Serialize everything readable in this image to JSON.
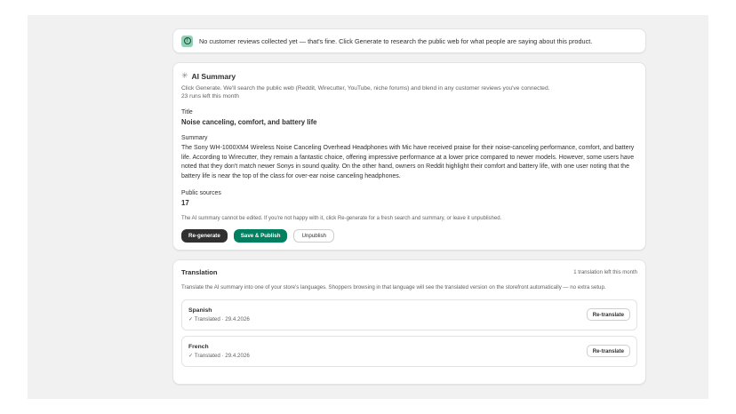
{
  "banner": {
    "text": "No customer reviews collected yet — that's fine. Click Generate to research the public web for what people are saying about this product."
  },
  "summary": {
    "title": "AI Summary",
    "subtitle": "Click Generate. We'll search the public web (Reddit, Wirecutter, YouTube, niche forums) and blend in any customer reviews you've connected.",
    "runs_left": "23 runs left this month",
    "title_label": "Title",
    "title_value": "Noise canceling, comfort, and battery life",
    "summary_label": "Summary",
    "summary_text": "The Sony WH-1000XM4 Wireless Noise Canceling Overhead Headphones with Mic have received praise for their noise-canceling performance, comfort, and battery life. According to Wirecutter, they remain a fantastic choice, offering impressive performance at a lower price compared to newer models. However, some users have noted that they don't match newer Sonys in sound quality. On the other hand, owners on Reddit highlight their comfort and battery life, with one user noting that the battery life is near the top of the class for over-ear noise canceling headphones.",
    "sources_label": "Public sources",
    "sources_value": "17",
    "note": "The AI summary cannot be edited. If you're not happy with it, click Re-generate for a fresh search and summary, or leave it unpublished.",
    "buttons": {
      "regenerate": "Re-generate",
      "save_publish": "Save & Publish",
      "unpublish": "Unpublish"
    }
  },
  "translation": {
    "title": "Translation",
    "left": "1 translation left this month",
    "description": "Translate the AI summary into one of your store's languages. Shoppers browsing in that language will see the translated version on the storefront automatically — no extra setup.",
    "languages": [
      {
        "name": "Spanish",
        "status": "✓ Translated · 29.4.2026",
        "button": "Re-translate"
      },
      {
        "name": "French",
        "status": "✓ Translated · 29.4.2026",
        "button": "Re-translate"
      }
    ]
  },
  "colors": {
    "primary_dark": "#303030",
    "publish_green": "#008060",
    "info_icon_bg": "#91d0b5"
  }
}
